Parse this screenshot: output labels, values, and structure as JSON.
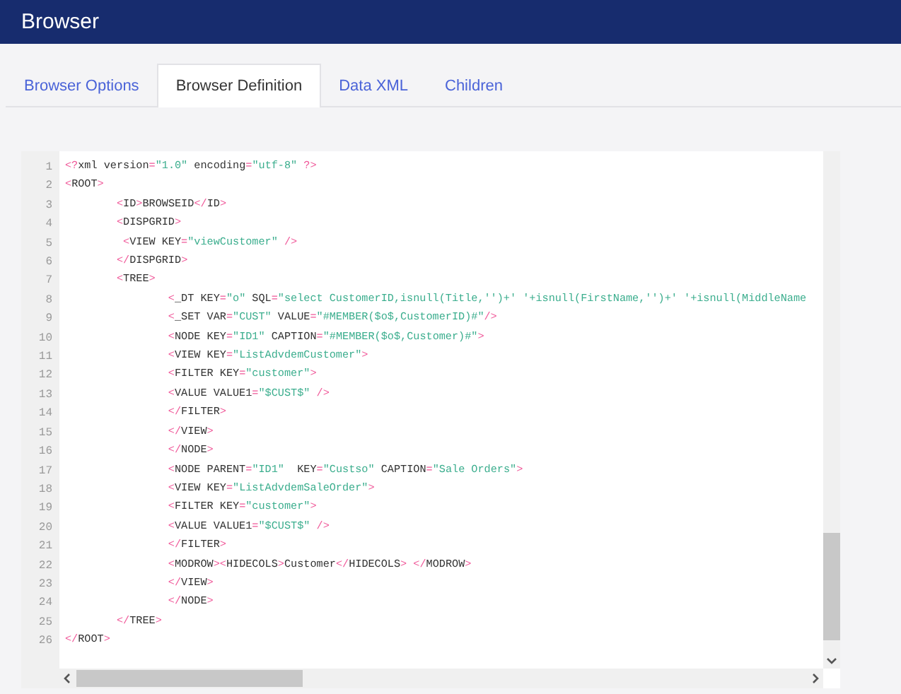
{
  "header": {
    "title": "Browser"
  },
  "tabs": [
    {
      "label": "Browser Options",
      "selected": false
    },
    {
      "label": "Browser Definition",
      "selected": true
    },
    {
      "label": "Data XML",
      "selected": false
    },
    {
      "label": "Children",
      "selected": false
    }
  ],
  "editor": {
    "lines": [
      {
        "number": "1",
        "text": "<?xml version=\"1.0\" encoding=\"utf-8\" ?>"
      },
      {
        "number": "2",
        "text": "<ROOT>"
      },
      {
        "number": "3",
        "text": "        <ID>BROWSEID</ID>"
      },
      {
        "number": "4",
        "text": "        <DISPGRID>"
      },
      {
        "number": "5",
        "text": "         <VIEW KEY=\"viewCustomer\" />"
      },
      {
        "number": "6",
        "text": "        </DISPGRID>"
      },
      {
        "number": "7",
        "text": "        <TREE>"
      },
      {
        "number": "8",
        "text": "                <_DT KEY=\"o\" SQL=\"select CustomerID,isnull(Title,'')+' '+isnull(FirstName,'')+' '+isnull(MiddleName"
      },
      {
        "number": "9",
        "text": "                <_SET VAR=\"CUST\" VALUE=\"#MEMBER($o$,CustomerID)#\"/>"
      },
      {
        "number": "10",
        "text": "                <NODE KEY=\"ID1\" CAPTION=\"#MEMBER($o$,Customer)#\">"
      },
      {
        "number": "11",
        "text": "                <VIEW KEY=\"ListAdvdemCustomer\">"
      },
      {
        "number": "12",
        "text": "                <FILTER KEY=\"customer\">"
      },
      {
        "number": "13",
        "text": "                <VALUE VALUE1=\"$CUST$\" />"
      },
      {
        "number": "14",
        "text": "                </FILTER>"
      },
      {
        "number": "15",
        "text": "                </VIEW>"
      },
      {
        "number": "16",
        "text": "                </NODE>"
      },
      {
        "number": "17",
        "text": "                <NODE PARENT=\"ID1\"  KEY=\"Custso\" CAPTION=\"Sale Orders\">"
      },
      {
        "number": "18",
        "text": "                <VIEW KEY=\"ListAdvdemSaleOrder\">"
      },
      {
        "number": "19",
        "text": "                <FILTER KEY=\"customer\">"
      },
      {
        "number": "20",
        "text": "                <VALUE VALUE1=\"$CUST$\" />"
      },
      {
        "number": "21",
        "text": "                </FILTER>"
      },
      {
        "number": "22",
        "text": "                <MODROW><HIDECOLS>Customer</HIDECOLS> </MODROW>"
      },
      {
        "number": "23",
        "text": "                </VIEW>"
      },
      {
        "number": "24",
        "text": "                </NODE>"
      },
      {
        "number": "25",
        "text": "        </TREE>"
      },
      {
        "number": "26",
        "text": "</ROOT>"
      }
    ]
  }
}
